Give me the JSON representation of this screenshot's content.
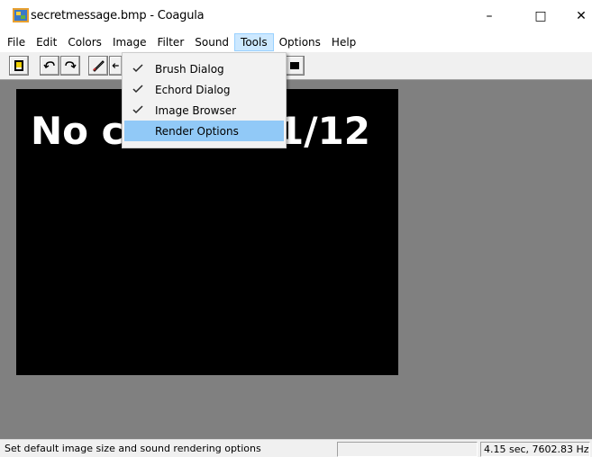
{
  "window": {
    "title": "secretmessage.bmp - Coagula",
    "minimize_glyph": "–",
    "maximize_glyph": "□",
    "close_glyph": "✕"
  },
  "menubar": {
    "items": [
      "File",
      "Edit",
      "Colors",
      "Image",
      "Filter",
      "Sound",
      "Tools",
      "Options",
      "Help"
    ],
    "active": "Tools"
  },
  "tools_menu": {
    "items": [
      {
        "label": "Brush Dialog",
        "checked": true
      },
      {
        "label": "Echord Dialog",
        "checked": true
      },
      {
        "label": "Image Browser",
        "checked": true
      },
      {
        "label": "Render Options",
        "checked": false,
        "highlighted": true
      }
    ]
  },
  "toolbar": {
    "icons": [
      "open-icon",
      "undo-icon",
      "redo-icon",
      "brush-icon",
      "arrow-icon",
      "stop-icon"
    ]
  },
  "canvas": {
    "text_left": "No c",
    "text_right": "1/12"
  },
  "statusbar": {
    "message": "Set default image size and sound rendering options",
    "middle": "",
    "info": "4.15 sec, 7602.83 Hz"
  },
  "colors": {
    "workspace": "#808080",
    "canvas": "#000000",
    "menu_highlight": "#91c9f7",
    "active_menu": "#cce8ff"
  }
}
